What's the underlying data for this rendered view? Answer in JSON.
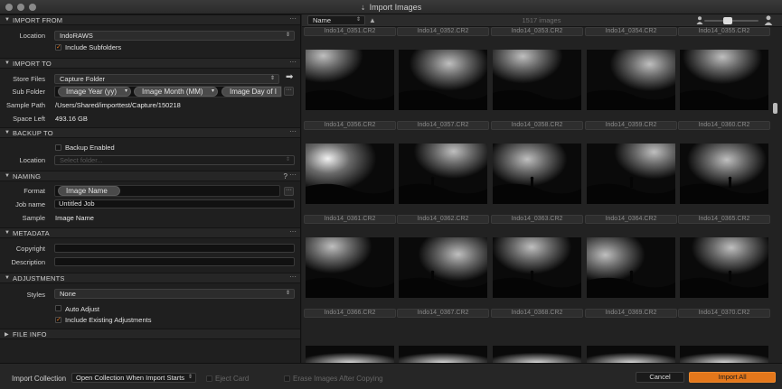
{
  "window": {
    "title": "Import Images",
    "title_icon": "import-icon"
  },
  "colors": {
    "accent": "#e4771b",
    "panel_bg": "#1f1f1f",
    "section_header_bg": "#262626",
    "browser_bg": "#222222"
  },
  "sections": {
    "import_from": {
      "title": "IMPORT FROM",
      "location_label": "Location",
      "location_value": "IndoRAWS",
      "include_subfolders_label": "Include Subfolders",
      "include_subfolders_checked": true
    },
    "import_to": {
      "title": "IMPORT TO",
      "store_files_label": "Store Files",
      "store_files_value": "Capture Folder",
      "sub_folder_label": "Sub Folder",
      "tokens": [
        "Image Year (yy)",
        "Image Month (MM)",
        "Image Day of I"
      ],
      "sample_path_label": "Sample Path",
      "sample_path_value": "/Users/Shared/importtest/Capture/150218",
      "space_left_label": "Space Left",
      "space_left_value": "493.16 GB"
    },
    "backup_to": {
      "title": "BACKUP TO",
      "backup_enabled_label": "Backup Enabled",
      "backup_enabled_checked": false,
      "location_label": "Location",
      "location_placeholder": "Select folder..."
    },
    "naming": {
      "title": "NAMING",
      "help_mark": "?",
      "format_label": "Format",
      "format_token": "Image Name",
      "job_name_label": "Job name",
      "job_name_value": "Untitled Job",
      "sample_label": "Sample",
      "sample_value": "Image Name"
    },
    "metadata": {
      "title": "METADATA",
      "copyright_label": "Copyright",
      "copyright_value": "",
      "description_label": "Description",
      "description_value": ""
    },
    "adjustments": {
      "title": "ADJUSTMENTS",
      "styles_label": "Styles",
      "styles_value": "None",
      "auto_adjust_label": "Auto Adjust",
      "auto_adjust_checked": false,
      "include_existing_label": "Include Existing Adjustments",
      "include_existing_checked": true
    },
    "file_info": {
      "title": "FILE INFO"
    }
  },
  "browser": {
    "sort_value": "Name",
    "sort_direction_glyph": "▲",
    "image_count": "1517 images",
    "thumbnail_size_level": 0.35,
    "rows": [
      [
        "Indo14_0351.CR2",
        "Indo14_0352.CR2",
        "Indo14_0353.CR2",
        "Indo14_0354.CR2",
        "Indo14_0355.CR2"
      ],
      [
        "Indo14_0356.CR2",
        "Indo14_0357.CR2",
        "Indo14_0358.CR2",
        "Indo14_0359.CR2",
        "Indo14_0360.CR2"
      ],
      [
        "Indo14_0361.CR2",
        "Indo14_0362.CR2",
        "Indo14_0363.CR2",
        "Indo14_0364.CR2",
        "Indo14_0365.CR2"
      ],
      [
        "Indo14_0366.CR2",
        "Indo14_0367.CR2",
        "Indo14_0368.CR2",
        "Indo14_0369.CR2",
        "Indo14_0370.CR2"
      ]
    ]
  },
  "bottom_bar": {
    "import_collection_label": "Import Collection",
    "import_collection_value": "Open Collection When Import Starts",
    "eject_card_label": "Eject Card",
    "erase_label": "Erase Images After Copying",
    "cancel_label": "Cancel",
    "import_all_label": "Import All"
  }
}
